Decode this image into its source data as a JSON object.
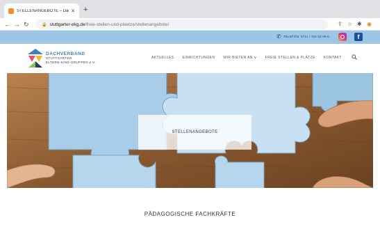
{
  "browser": {
    "tab_title": "STELLENANGEBOTE – Dachve",
    "new_tab": "+",
    "url_host": "stuttgarter-ekg.de",
    "url_path": "/freie-stellen-und-plaetze/stellenangebote/"
  },
  "topbar": {
    "phone": "TELEFON: 0711 / 762 03 08-0"
  },
  "logo": {
    "line1": "DACHVERBAND",
    "line2": "STUTTGARTER",
    "line3": "ELTERN-KIND-GRUPPEN e.V."
  },
  "nav": {
    "items": [
      "AKTUELLES",
      "EINRICHTUNGEN",
      "WIR BIETEN AN ∨",
      "FREIE STELLEN & PLÄTZE",
      "KONTAKT"
    ]
  },
  "hero": {
    "label": "STELLENANGEBOTE"
  },
  "section": {
    "title": "PÄDAGOGISCHE FACHKRÄFTE"
  },
  "colors": {
    "topbar": "#9cc6e6",
    "logo_blue": "#3a7fc2",
    "puzzle": "#a9cde8"
  }
}
